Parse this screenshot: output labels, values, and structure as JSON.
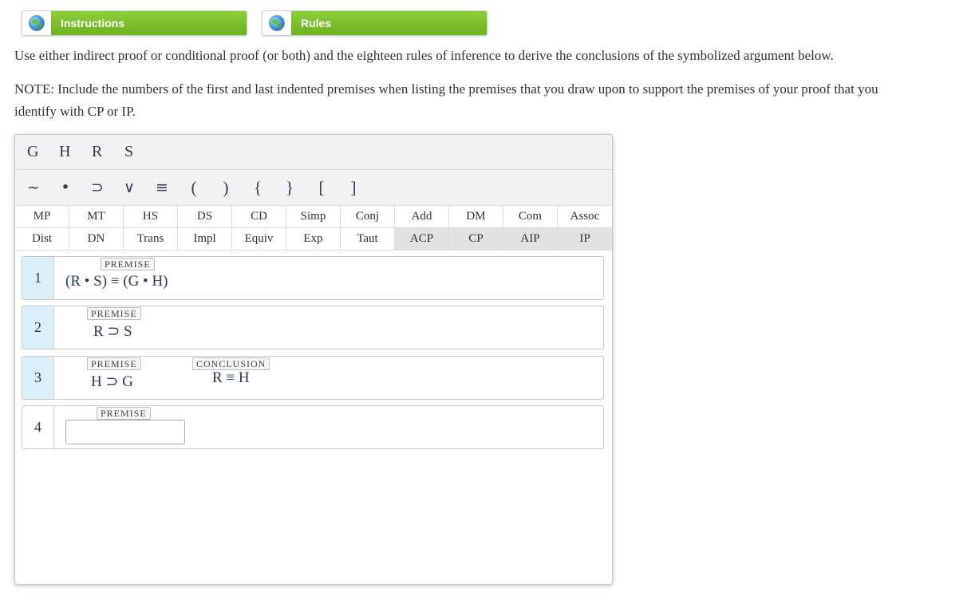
{
  "tabs": {
    "instructions_label": "Instructions",
    "rules_label": "Rules"
  },
  "instructions_text": "Use either indirect proof or conditional proof (or both) and the eighteen rules of inference to derive the conclusions of the symbolized argument below.",
  "note_line1": "NOTE: Include the numbers of the first and last indented premises when listing the premises that you draw upon to support the premises of your proof that you",
  "note_line2": "identify with CP or IP.",
  "variables": [
    "G",
    "H",
    "R",
    "S"
  ],
  "symbols": {
    "tilde": "~",
    "dot": "•",
    "horseshoe": "⊃",
    "wedge": "∨",
    "triple_bar": "≡",
    "lparen": "(",
    "rparen": ")",
    "lbrace": "{",
    "rbrace": "}",
    "lbracket": "[",
    "rbracket": "]"
  },
  "rules_row1": [
    "MP",
    "MT",
    "HS",
    "DS",
    "CD",
    "Simp",
    "Conj",
    "Add",
    "DM",
    "Com",
    "Assoc"
  ],
  "rules_row2": [
    "Dist",
    "DN",
    "Trans",
    "Impl",
    "Equiv",
    "Exp",
    "Taut",
    "ACP",
    "CP",
    "AIP",
    "IP"
  ],
  "lines": {
    "l1": {
      "num": "1",
      "tag": "PREMISE",
      "expr": "(R • S) ≡ (G • H)"
    },
    "l2": {
      "num": "2",
      "tag": "PREMISE",
      "expr": "R ⊃ S"
    },
    "l3": {
      "num": "3",
      "tag": "PREMISE",
      "expr": "H ⊃ G",
      "conclusion_tag": "CONCLUSION",
      "conclusion_expr": "R ≡ H"
    },
    "l4": {
      "num": "4",
      "tag": "PREMISE",
      "input_value": ""
    }
  }
}
